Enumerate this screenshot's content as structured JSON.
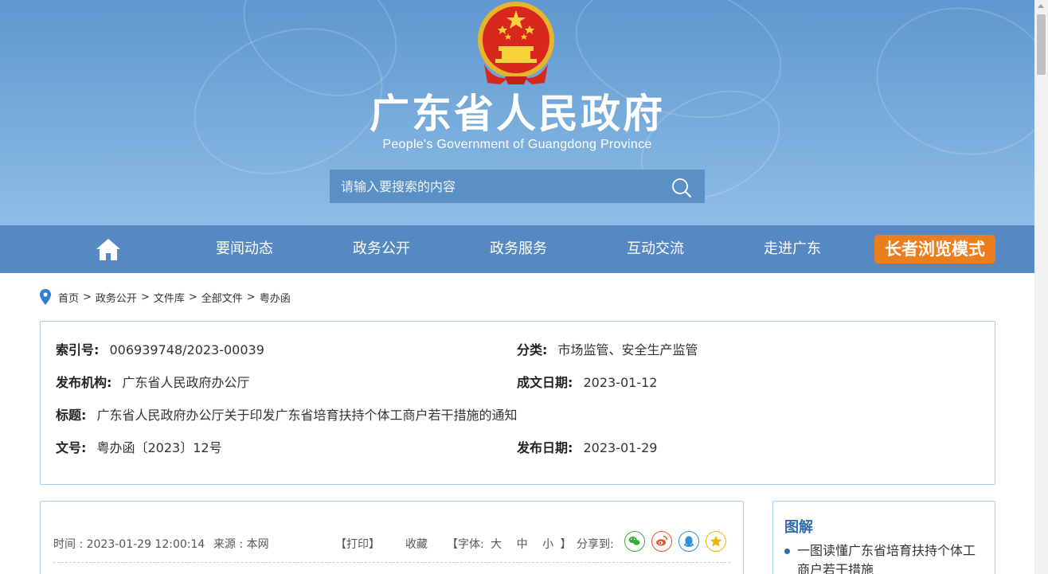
{
  "header": {
    "title": "广东省人民政府",
    "subtitle": "People's Government of Guangdong Province",
    "emblem_icon": "national-emblem-icon"
  },
  "search": {
    "placeholder": "请输入要搜索的内容",
    "icon": "search-icon"
  },
  "nav": {
    "home_icon": "home-icon",
    "items": [
      "要闻动态",
      "政务公开",
      "政务服务",
      "互动交流",
      "走进广东"
    ],
    "elder_mode": "长者浏览模式"
  },
  "breadcrumb": {
    "icon": "location-pin-icon",
    "items": [
      "首页",
      "政务公开",
      "文件库",
      "全部文件",
      "粤办函"
    ],
    "separator": ">"
  },
  "info": {
    "index_label": "索引号:",
    "index_value": "006939748/2023-00039",
    "category_label": "分类:",
    "category_value": "市场监管、安全生产监管",
    "publisher_label": "发布机构:",
    "publisher_value": "广东省人民政府办公厅",
    "created_label": "成文日期:",
    "created_value": "2023-01-12",
    "title_label": "标题:",
    "title_value": "广东省人民政府办公厅关于印发广东省培育扶持个体工商户若干措施的通知",
    "doc_no_label": "文号:",
    "doc_no_value": "粤办函〔2023〕12号",
    "published_label": "发布日期:",
    "published_value": "2023-01-29"
  },
  "article": {
    "time": "时间 : 2023-01-29 12:00:14",
    "source": "来源 : 本网",
    "print": "【打印】",
    "favorite": "收藏",
    "font_prefix": "【字体:",
    "font_large": "大",
    "font_medium": "中",
    "font_small": "小",
    "font_suffix": "】",
    "share_label": "分享到:",
    "share_icons": [
      "wechat-icon",
      "weibo-icon",
      "qq-icon",
      "qzone-icon"
    ],
    "colors": {
      "wechat": "#3aae3a",
      "weibo": "#e6572c",
      "qq": "#2f8fd8",
      "qzone": "#f0b400"
    }
  },
  "side": {
    "title": "图解",
    "items": [
      "一图读懂广东省培育扶持个体工商户若干措施"
    ]
  },
  "colors": {
    "header_blue": "#6aa2d6",
    "nav_blue": "#5689c1",
    "elder_orange": "#ec7d1d",
    "border_blue": "#a8cde6",
    "side_title": "#2f6bae"
  }
}
